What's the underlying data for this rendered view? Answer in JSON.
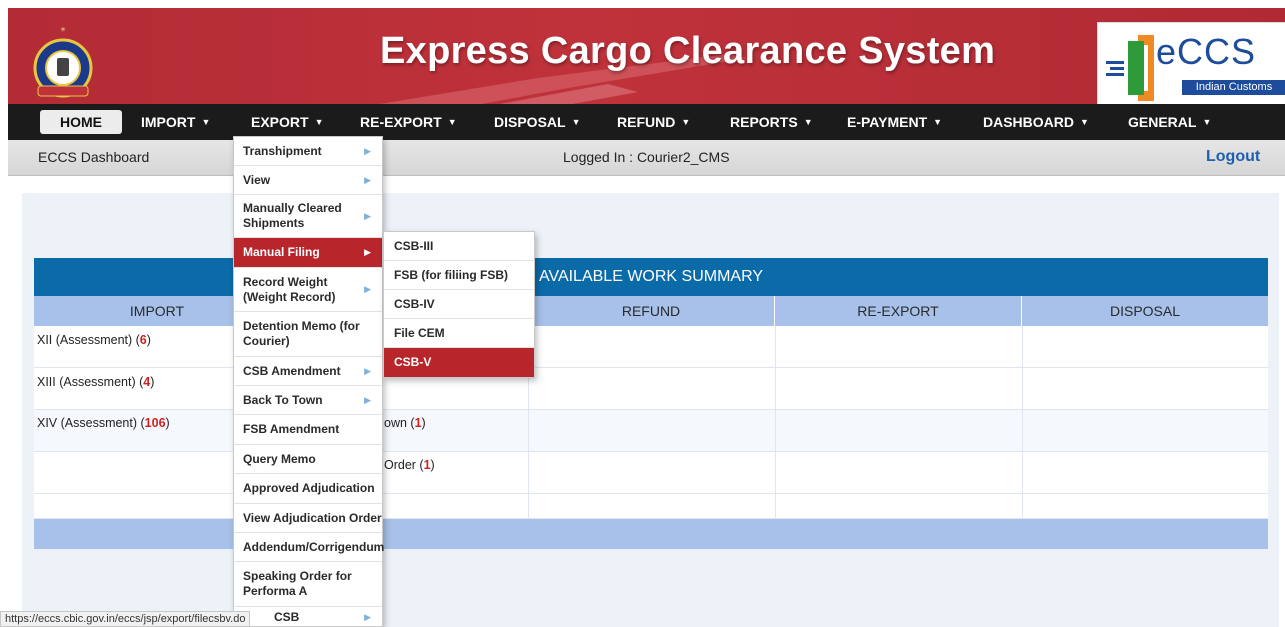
{
  "header": {
    "title": "Express Cargo Clearance System",
    "logo_text": "eCCS",
    "logo_sub": "Indian Customs"
  },
  "nav": {
    "home": "HOME",
    "items": [
      "IMPORT",
      "EXPORT",
      "RE-EXPORT",
      "DISPOSAL",
      "REFUND",
      "REPORTS",
      "E-PAYMENT",
      "DASHBOARD",
      "GENERAL"
    ]
  },
  "subbar": {
    "dashboard": "ECCS Dashboard",
    "logged_in": "Logged In : Courier2_CMS",
    "logout": "Logout"
  },
  "summary": {
    "title": "AVAILABLE WORK SUMMARY",
    "columns": [
      "IMPORT",
      "REFUND",
      "RE-EXPORT",
      "DISPOSAL"
    ],
    "import_rows": [
      {
        "label": "XII (Assessment) (",
        "count": "6",
        "close": ")"
      },
      {
        "label": "XIII (Assessment) (",
        "count": "4",
        "close": ")"
      },
      {
        "label": "XIV (Assessment) (",
        "count": "106",
        "close": ")"
      }
    ],
    "export_partial": [
      {
        "label": "own (",
        "count": "1",
        "close": ")"
      },
      {
        "label": "Order (",
        "count": "1",
        "close": ")"
      }
    ]
  },
  "export_menu": {
    "items": [
      "Transhipment",
      "View",
      "Manually Cleared Shipments",
      "Manual Filing",
      "Record Weight (Weight Record)",
      "Detention Memo (for Courier)",
      "CSB Amendment",
      "Back To Town",
      "FSB Amendment",
      "Query Memo",
      "Approved Adjudication",
      "View Adjudication Order",
      "Addendum/Corrigendum",
      "Speaking Order for Performa A",
      "CSB"
    ]
  },
  "manual_filing_menu": {
    "items": [
      "CSB-III",
      "FSB (for filiing FSB)",
      "CSB-IV",
      "File CEM",
      "CSB-V"
    ]
  },
  "status_url": "https://eccs.cbic.gov.in/eccs/jsp/export/filecsbv.do"
}
